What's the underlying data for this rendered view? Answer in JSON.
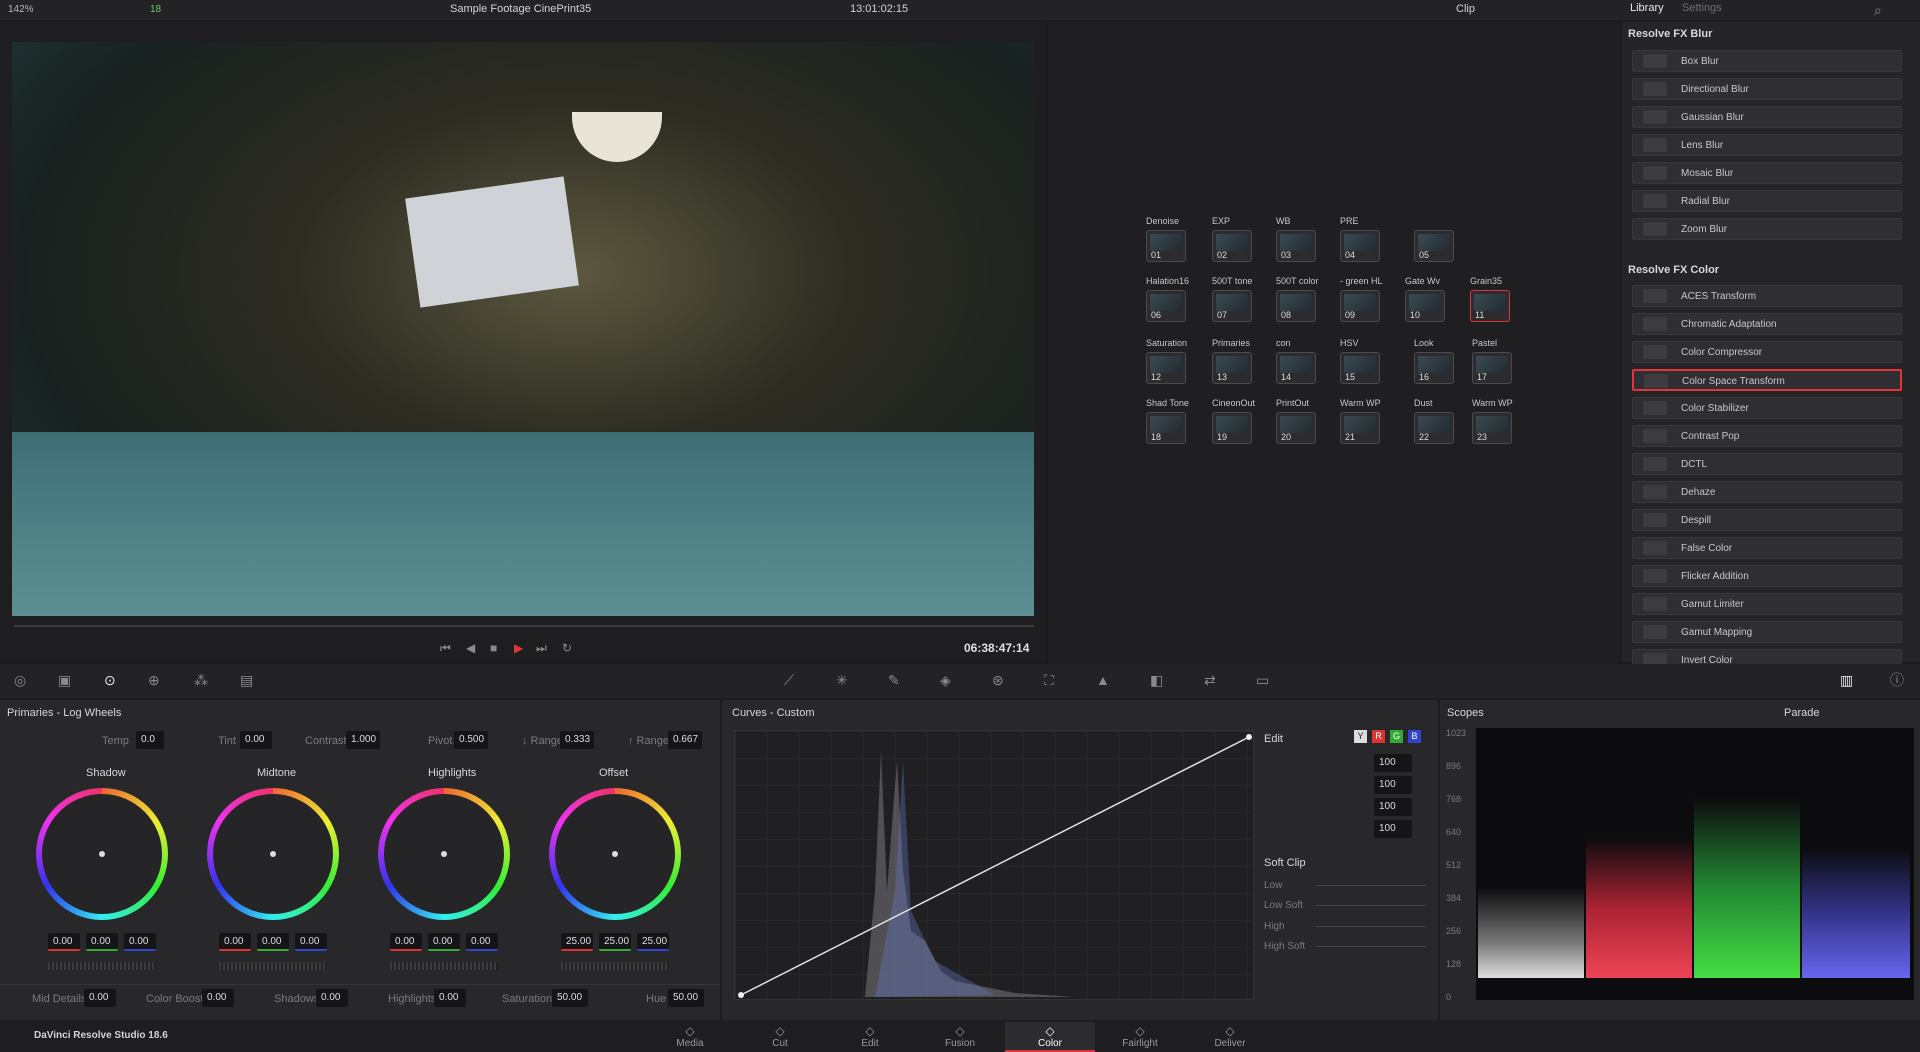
{
  "topbar": {
    "zoom": "142%",
    "count": "18",
    "clip_title": "Sample Footage CinePrint35",
    "timecode": "13:01:02:15",
    "clip_mode": "Clip"
  },
  "library": {
    "tab_library": "Library",
    "tab_settings": "Settings",
    "blur_header": "Resolve FX Blur",
    "blur_items": [
      "Box Blur",
      "Directional Blur",
      "Gaussian Blur",
      "Lens Blur",
      "Mosaic Blur",
      "Radial Blur",
      "Zoom Blur"
    ],
    "color_header": "Resolve FX Color",
    "color_items": [
      "ACES Transform",
      "Chromatic Adaptation",
      "Color Compressor",
      "Color Space Transform",
      "Color Stabilizer",
      "Contrast Pop",
      "DCTL",
      "Dehaze",
      "Despill",
      "False Color",
      "Flicker Addition",
      "Gamut Limiter",
      "Gamut Mapping",
      "Invert Color"
    ],
    "selected": "Color Space Transform"
  },
  "viewer": {
    "timecode": "06:38:47:14"
  },
  "nodes": [
    {
      "label": "Denoise",
      "num": "01"
    },
    {
      "label": "EXP",
      "num": "02"
    },
    {
      "label": "WB",
      "num": "03"
    },
    {
      "label": "PRE",
      "num": "04"
    },
    {
      "label": "",
      "num": "05"
    },
    {
      "label": "Halation16",
      "num": "06"
    },
    {
      "label": "500T tone",
      "num": "07"
    },
    {
      "label": "500T color",
      "num": "08"
    },
    {
      "label": "- green HL",
      "num": "09"
    },
    {
      "label": "Gate Wv",
      "num": "10"
    },
    {
      "label": "Grain35",
      "num": "11"
    },
    {
      "label": "Saturation",
      "num": "12"
    },
    {
      "label": "Primaries",
      "num": "13"
    },
    {
      "label": "con",
      "num": "14"
    },
    {
      "label": "HSV",
      "num": "15"
    },
    {
      "label": "Look",
      "num": "16"
    },
    {
      "label": "Pastel",
      "num": "17"
    },
    {
      "label": "Shad Tone",
      "num": "18"
    },
    {
      "label": "CineonOut",
      "num": "19"
    },
    {
      "label": "PrintOut",
      "num": "20"
    },
    {
      "label": "Warm WP",
      "num": "21"
    },
    {
      "label": "Dust",
      "num": "22"
    },
    {
      "label": "Warm WP",
      "num": "23"
    }
  ],
  "primaries": {
    "title": "Primaries - Log Wheels",
    "temp_label": "Temp",
    "temp": "0.0",
    "tint_label": "Tint",
    "tint": "0.00",
    "contrast_label": "Contrast",
    "contrast": "1.000",
    "pivot_label": "Pivot",
    "pivot": "0.500",
    "lrange_label": "↓ Range",
    "lrange": "0.333",
    "urange_label": "↑ Range",
    "urange": "0.667",
    "wheels": [
      {
        "name": "Shadow",
        "vals": [
          "0.00",
          "0.00",
          "0.00"
        ]
      },
      {
        "name": "Midtone",
        "vals": [
          "0.00",
          "0.00",
          "0.00"
        ]
      },
      {
        "name": "Highlights",
        "vals": [
          "0.00",
          "0.00",
          "0.00"
        ]
      },
      {
        "name": "Offset",
        "vals": [
          "25.00",
          "25.00",
          "25.00"
        ]
      }
    ],
    "middetails_label": "Mid Details",
    "middetails": "0.00",
    "boost_label": "Color Boost",
    "boost": "0.00",
    "shadows_label": "Shadows",
    "shadows": "0.00",
    "highlights_label": "Highlights",
    "highlights": "0.00",
    "sat_label": "Saturation",
    "sat": "50.00",
    "hue_label": "Hue",
    "hue": "50.00"
  },
  "curves": {
    "title": "Curves - Custom",
    "edit_label": "Edit",
    "vals": [
      "100",
      "100",
      "100",
      "100"
    ],
    "softclip_label": "Soft Clip",
    "low": "Low",
    "lowsoft": "Low Soft",
    "high": "High",
    "highsoft": "High Soft",
    "y": "Y",
    "r": "R",
    "g": "G",
    "b": "B"
  },
  "scopes": {
    "title": "Scopes",
    "mode": "Parade",
    "ticks": [
      "1023",
      "896",
      "768",
      "640",
      "512",
      "384",
      "256",
      "128",
      "0"
    ]
  },
  "footer": {
    "app": "DaVinci Resolve Studio 18.6",
    "tabs": [
      "Media",
      "Cut",
      "Edit",
      "Fusion",
      "Color",
      "Fairlight",
      "Deliver"
    ],
    "active": "Color"
  },
  "colors": {
    "accent": "#e0343a",
    "bg": "#1c1c1f",
    "panel": "#28282b"
  }
}
